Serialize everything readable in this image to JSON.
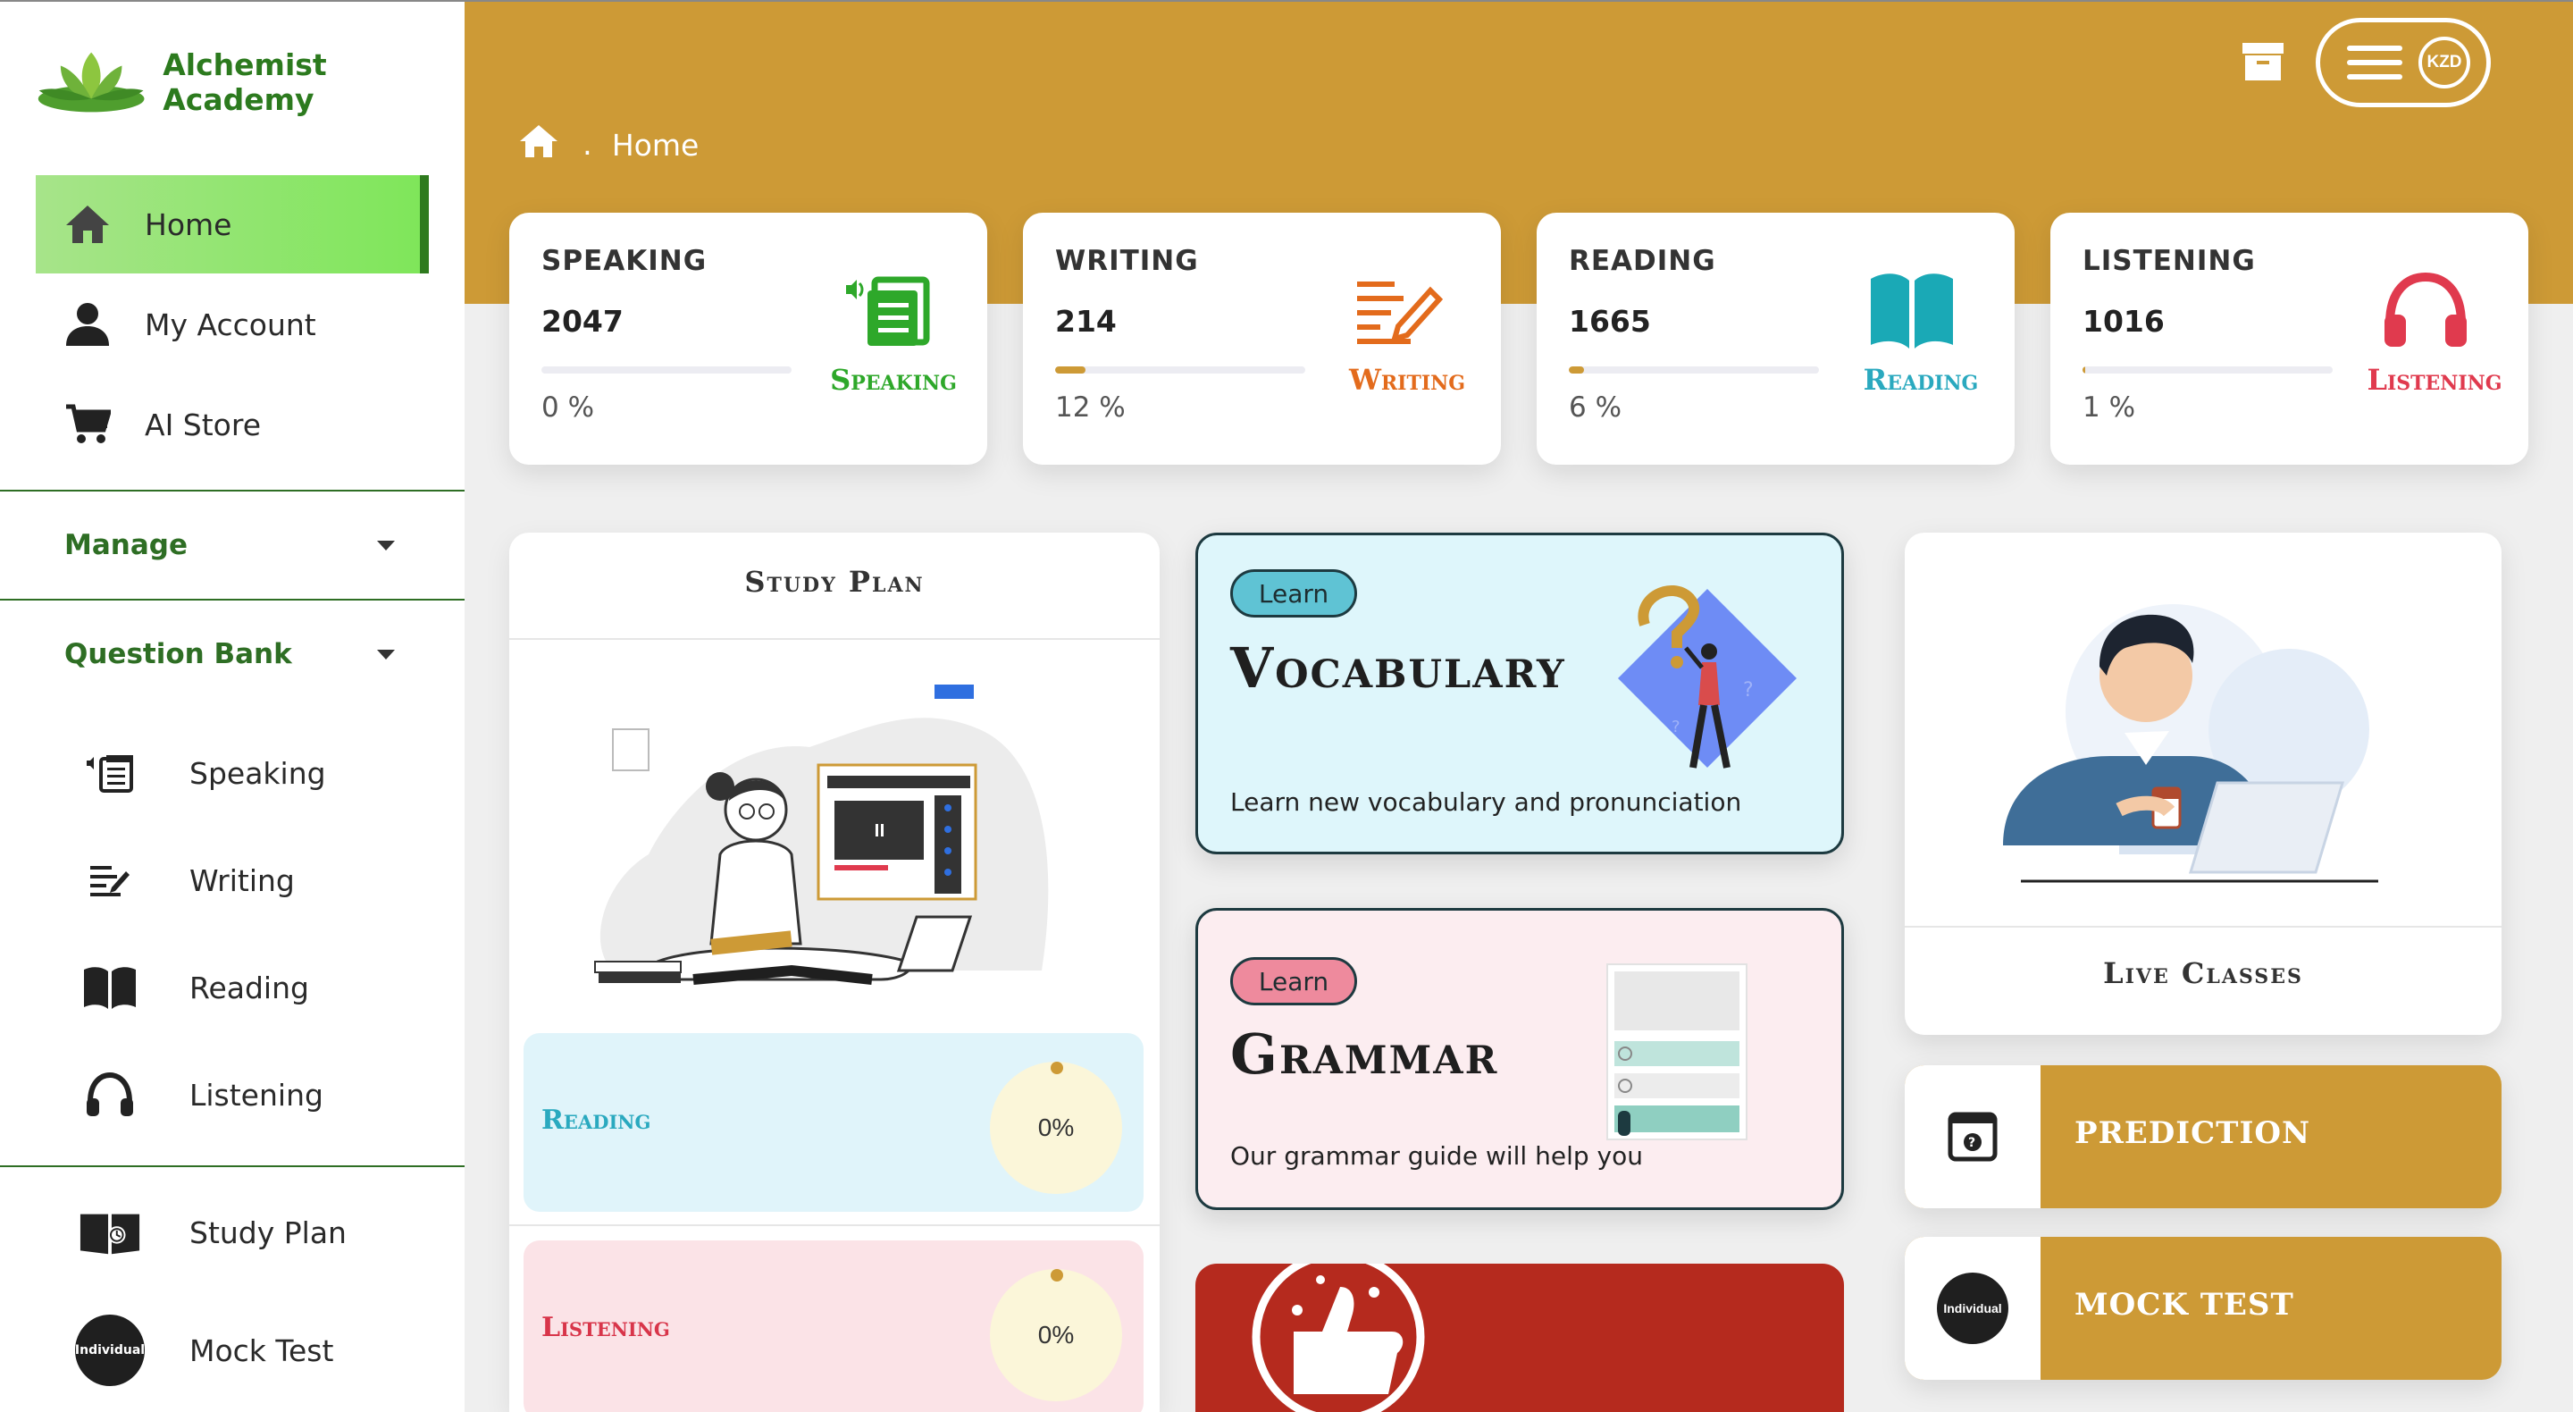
{
  "brand": {
    "name": "Alchemist Academy"
  },
  "sidebar": {
    "primary": [
      {
        "label": "Home",
        "icon": "home-icon",
        "active": true
      },
      {
        "label": "My Account",
        "icon": "user-icon"
      },
      {
        "label": "AI Store",
        "icon": "cart-icon"
      }
    ],
    "manage": {
      "label": "Manage"
    },
    "question_bank": {
      "label": "Question Bank",
      "items": [
        {
          "label": "Speaking",
          "icon": "speaking-icon"
        },
        {
          "label": "Writing",
          "icon": "writing-icon"
        },
        {
          "label": "Reading",
          "icon": "reading-book-icon"
        },
        {
          "label": "Listening",
          "icon": "headphones-icon"
        }
      ]
    },
    "extra": [
      {
        "label": "Study Plan",
        "icon": "study-plan-icon"
      },
      {
        "label": "Mock Test",
        "icon": "individual-badge",
        "badge": "Individual"
      }
    ]
  },
  "header": {
    "breadcrumb": {
      "separator": ".",
      "current": "Home"
    },
    "user_initials": "KZD"
  },
  "stats": [
    {
      "title": "SPEAKING",
      "count": "2047",
      "percent_text": "0 %",
      "progress": 0,
      "label": "Speaking",
      "color": "#2ea82a"
    },
    {
      "title": "WRITING",
      "count": "214",
      "percent_text": "12 %",
      "progress": 12,
      "label": "Writing",
      "color": "#e36b1c"
    },
    {
      "title": "READING",
      "count": "1665",
      "percent_text": "6 %",
      "progress": 6,
      "label": "Reading",
      "color": "#2aa9bf"
    },
    {
      "title": "LISTENING",
      "count": "1016",
      "percent_text": "1 %",
      "progress": 1,
      "label": "Listening",
      "color": "#e03a4e"
    }
  ],
  "study_plan": {
    "title": "Study Plan",
    "items": [
      {
        "label": "Reading",
        "percent_text": "0%",
        "color": "#2aa9bf",
        "bg": "#e0f4fa"
      },
      {
        "label": "Listening",
        "percent_text": "0%",
        "color": "#d8354a",
        "bg": "#fbe3e7"
      }
    ]
  },
  "learn_cards": [
    {
      "tag": "Learn",
      "title": "Vocabulary",
      "desc": "Learn new vocabulary and pronunciation",
      "bg": "#def6fb",
      "tag_bg": "#5fc3d4"
    },
    {
      "tag": "Learn",
      "title": "Grammar",
      "desc": "Our grammar guide will help you",
      "bg": "#fcedf0",
      "tag_bg": "#ee8a9d"
    }
  ],
  "live_classes": {
    "title": "Live Classes"
  },
  "actions": [
    {
      "label": "PREDICTION",
      "icon": "prediction-icon"
    },
    {
      "label": "MOCK TEST",
      "icon": "individual-badge",
      "badge": "Individual"
    }
  ]
}
